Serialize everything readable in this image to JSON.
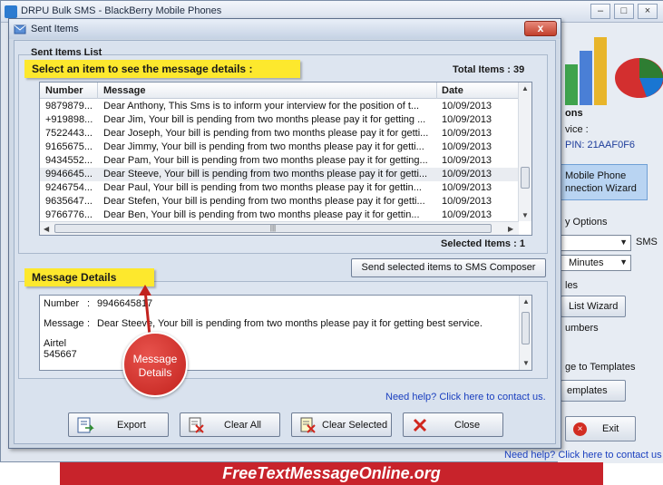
{
  "main_window": {
    "title": "DRPU Bulk SMS - BlackBerry Mobile Phones",
    "side_texts": {
      "options_heading": "ons",
      "device_label": "vice :",
      "pin": "PIN: 21AAF0F6",
      "wizard_line1": "Mobile Phone",
      "wizard_line2": "nnection  Wizard",
      "delivery_options": "y Options",
      "sms_label": "SMS",
      "minutes_value": "Minutes",
      "les_label": "les",
      "list_wizard_button": "List Wizard",
      "numbers_label": "umbers",
      "templates_label": "ge to Templates",
      "templates_button": "emplates",
      "exit_button": "Exit"
    },
    "help_link": "Need help? Click here to contact us"
  },
  "dialog": {
    "title": "Sent Items",
    "close_symbol": "x",
    "sent_items_list_label": "Sent Items List",
    "select_banner": "Select an item to see the message details :",
    "total_items": "Total Items : 39",
    "selected_items": "Selected Items : 1",
    "send_to_composer_button": "Send selected items to SMS Composer",
    "message_details_banner": "Message Details",
    "help_link": "Need help? Click here to contact us.",
    "table": {
      "columns": [
        "Number",
        "Message",
        "Date"
      ],
      "rows": [
        {
          "number": "9879879...",
          "message": "Dear Anthony, This Sms is to inform your interview for the position of t...",
          "date": "10/09/2013"
        },
        {
          "number": "+919898...",
          "message": "Dear Jim, Your bill is pending from two months please pay it for getting ...",
          "date": "10/09/2013"
        },
        {
          "number": "7522443...",
          "message": "Dear Joseph, Your bill is pending from two months please pay it for getti...",
          "date": "10/09/2013"
        },
        {
          "number": "9165675...",
          "message": "Dear Jimmy, Your bill is pending from two months please pay it for getti...",
          "date": "10/09/2013"
        },
        {
          "number": "9434552...",
          "message": "Dear Pam, Your bill is pending from two months please pay it for getting...",
          "date": "10/09/2013"
        },
        {
          "number": "9946645...",
          "message": "Dear Steeve, Your bill is pending from two months please pay it for getti...",
          "date": "10/09/2013"
        },
        {
          "number": "9246754...",
          "message": "Dear Paul, Your bill is pending from two months please pay it for gettin...",
          "date": "10/09/2013"
        },
        {
          "number": "9635647...",
          "message": "Dear Stefen, Your bill is pending from two months please pay it for getti...",
          "date": "10/09/2013"
        },
        {
          "number": "9766776...",
          "message": "Dear Ben, Your bill is pending from two months please pay it for gettin...",
          "date": "10/09/2013"
        }
      ],
      "selected_row_index": 5
    },
    "details": {
      "number_label": "Number",
      "number_sep": ":",
      "number_value": "9946645817",
      "message_label": "Message",
      "message_sep": ":",
      "message_value": "Dear Steeve, Your bill is pending from two months please pay it for getting best service.",
      "carrier": "Airtel",
      "code": "545667"
    },
    "buttons": {
      "export": "Export",
      "clear_all": "Clear All",
      "clear_selected": "Clear Selected",
      "close": "Close"
    }
  },
  "callout": {
    "line1": "Message",
    "line2": "Details"
  },
  "footer_banner": "FreeTextMessageOnline.org",
  "colors": {
    "banner_yellow": "#fde82d",
    "callout_red": "#c2221d",
    "footer_red": "#c8232b",
    "link_blue": "#1a3fbf"
  }
}
